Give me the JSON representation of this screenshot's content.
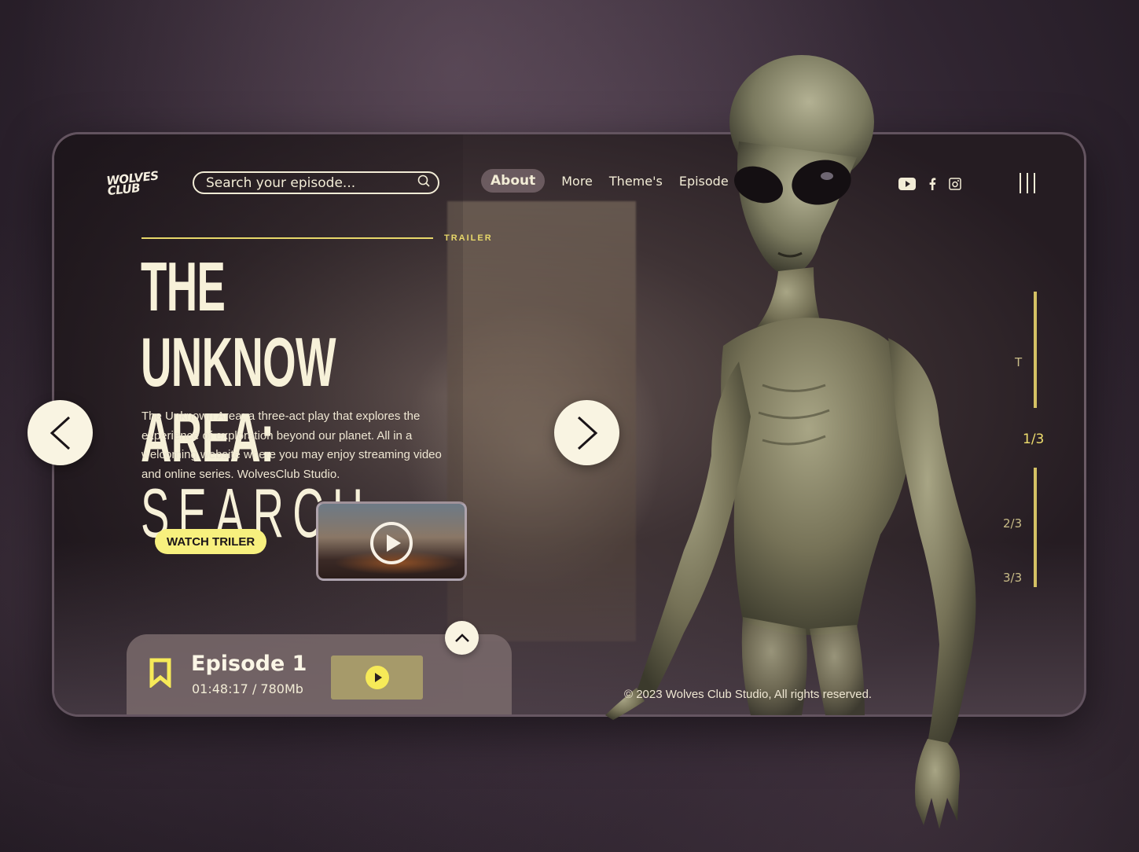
{
  "logo": {
    "text": "WOLVES CLUB"
  },
  "search": {
    "placeholder": "Search your episode..."
  },
  "nav": [
    {
      "label": "About",
      "active": true
    },
    {
      "label": "More"
    },
    {
      "label": "Theme's"
    },
    {
      "label": "Episode"
    }
  ],
  "social": {
    "icons": [
      "youtube-icon",
      "facebook-icon",
      "instagram-icon"
    ]
  },
  "hero": {
    "trailer_label": "TRAILER",
    "title_line1": "THE UNKNOW",
    "title_line2_bold": "AREA:",
    "title_line2_light": "SEARCH",
    "description": "The Unknown Area: a three-act play that explores the experience of exploration beyond our planet. All in a welcoming website where you may enjoy streaming video and online series. WolvesClub Studio.",
    "watch_button": "WATCH TRILER"
  },
  "episode": {
    "title": "Episode 1",
    "meta": "01:48:17 / 780Mb"
  },
  "footer": {
    "copyright": "© 2023 Wolves Club Studio, All rights reserved."
  },
  "pager": {
    "top_label": "T",
    "items": [
      "1/3",
      "2/3",
      "3/3"
    ],
    "active_index": 0
  },
  "colors": {
    "accent": "#f7f07e",
    "text": "#f2ecd6",
    "pager": "#d4c164"
  }
}
